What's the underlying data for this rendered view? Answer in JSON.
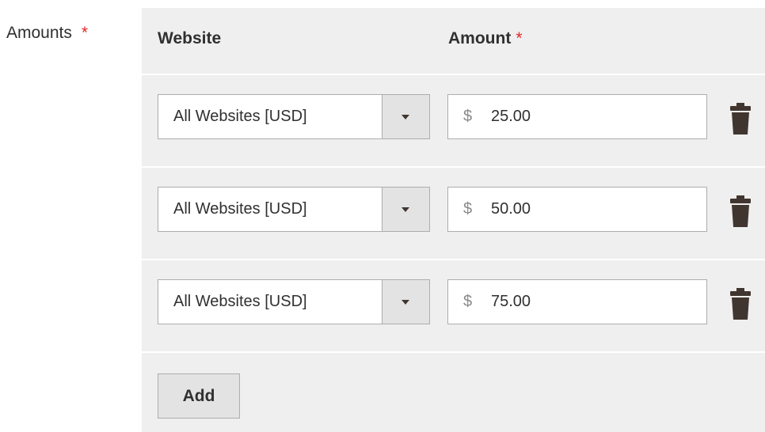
{
  "field": {
    "label": "Amounts",
    "required_mark": "*"
  },
  "table": {
    "headers": {
      "website": "Website",
      "amount": "Amount",
      "amount_required_mark": "*"
    },
    "rows": [
      {
        "website": "All Websites [USD]",
        "currency": "$",
        "amount": "25.00",
        "delete_icon": "trash-icon"
      },
      {
        "website": "All Websites [USD]",
        "currency": "$",
        "amount": "50.00",
        "delete_icon": "trash-icon"
      },
      {
        "website": "All Websites [USD]",
        "currency": "$",
        "amount": "75.00",
        "delete_icon": "trash-icon"
      }
    ],
    "add_label": "Add"
  },
  "colors": {
    "panel_bg": "#efefef",
    "required": "#e22626",
    "text": "#303030",
    "border": "#adadad",
    "icon": "#41362f"
  }
}
